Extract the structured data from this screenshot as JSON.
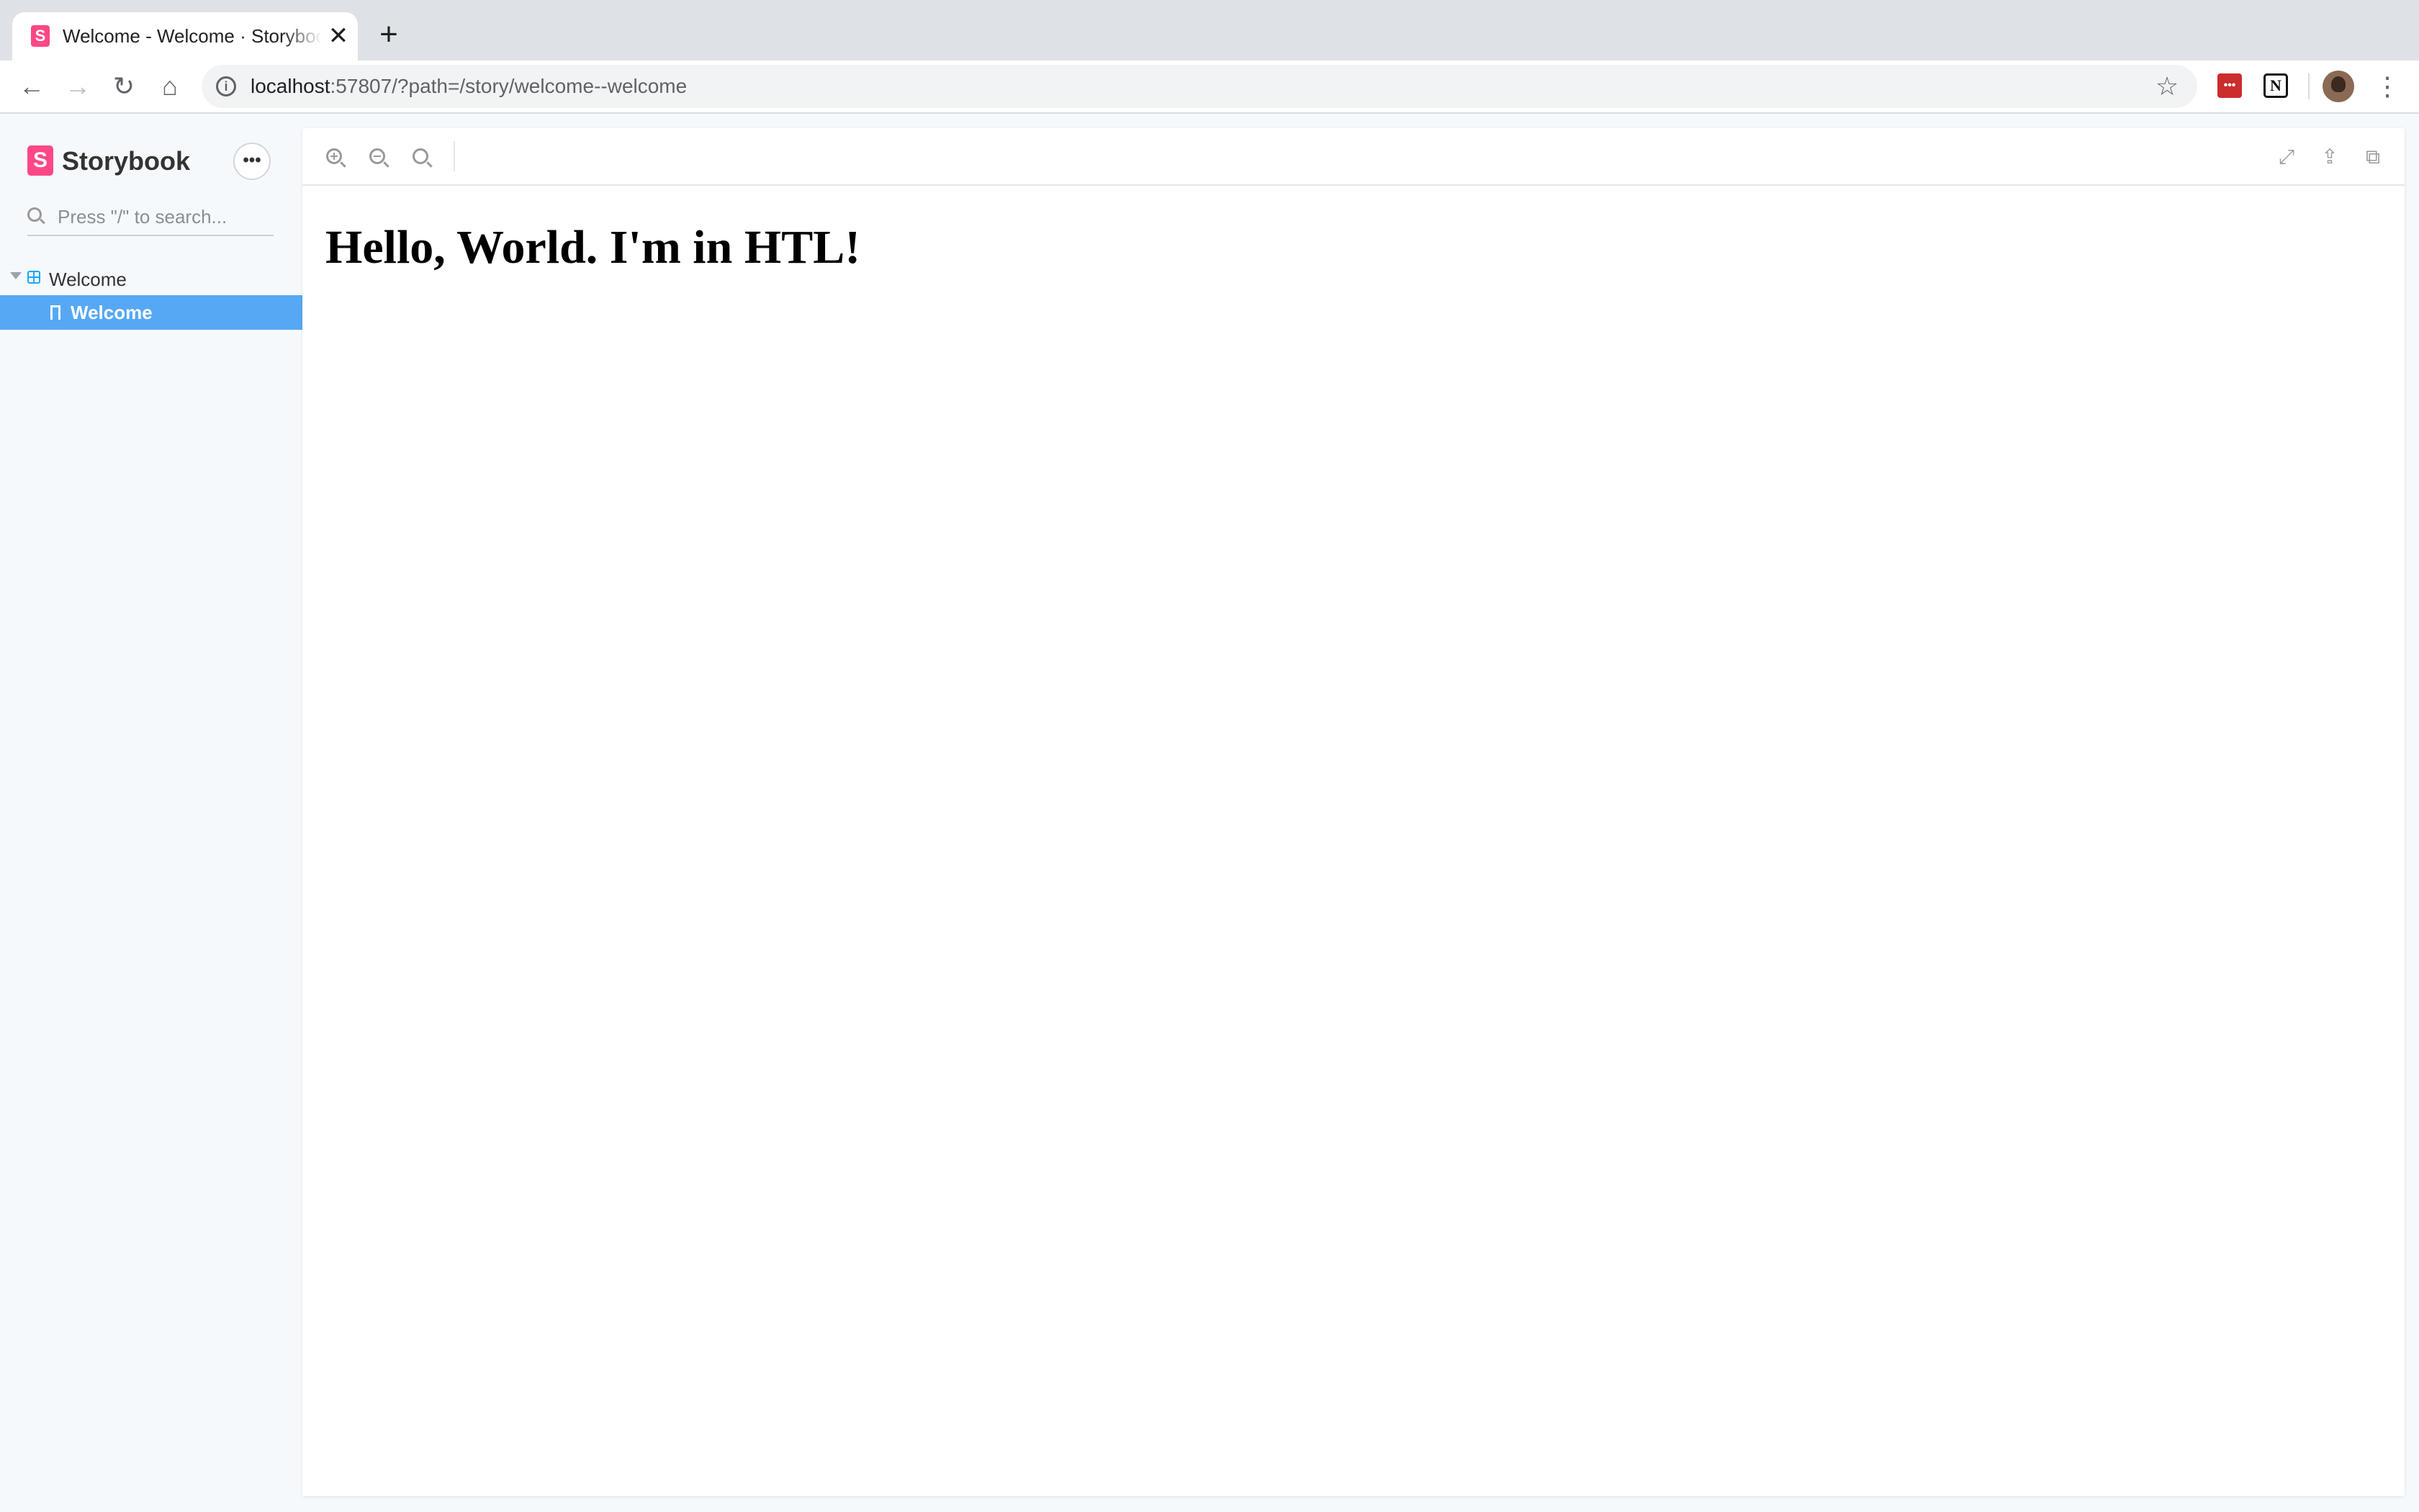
{
  "browser": {
    "tab": {
      "title": "Welcome - Welcome · Storybook",
      "favicon_letter": "S",
      "close_glyph": "✕"
    },
    "new_tab_glyph": "+",
    "nav": {
      "back_glyph": "←",
      "forward_glyph": "→",
      "reload_glyph": "↻",
      "home_glyph": "⌂"
    },
    "address": {
      "host": "localhost",
      "rest": ":57807/?path=/story/welcome--welcome",
      "info_glyph": "i",
      "star_glyph": "☆"
    },
    "extensions": {
      "red_ext_glyph": "•••",
      "notion_glyph": "N"
    },
    "menu_glyph": "⋮"
  },
  "sidebar": {
    "logo_letter": "S",
    "brand": "Storybook",
    "menu_glyph": "•••",
    "search_placeholder": "Press \"/\" to search...",
    "tree": {
      "group_label": "Welcome",
      "story_label": "Welcome"
    }
  },
  "preview": {
    "toolbar": {
      "zoom_in": "zoom-in",
      "zoom_out": "zoom-out",
      "zoom_reset": "zoom-reset",
      "fullscreen_glyph": "⤢",
      "share_glyph": "⇪",
      "copy_glyph": "⧉"
    },
    "story_heading": "Hello, World. I'm in HTL!"
  },
  "colors": {
    "storybook_pink": "#ff4785",
    "selected_item": "#56a8f5",
    "sidebar_bg": "#f6f9fc",
    "chrome_tabstrip": "#dee1e6"
  }
}
